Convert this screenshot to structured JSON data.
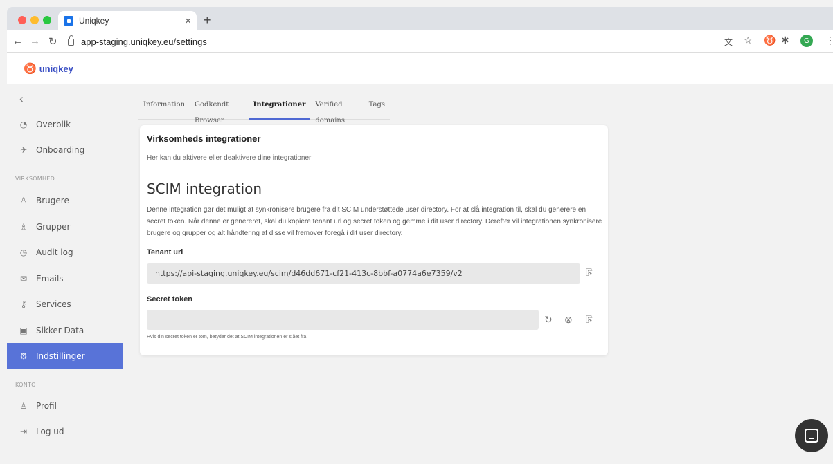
{
  "browser": {
    "tab_title": "Uniqkey",
    "tab_close": "×",
    "new_tab": "+",
    "url": "app-staging.uniqkey.eu/settings",
    "avatar_letter": "G"
  },
  "app": {
    "logo_text": "uniqkey"
  },
  "sidebar": {
    "items_top": [
      {
        "label": "Overblik",
        "icon": "gauge-icon"
      },
      {
        "label": "Onboarding",
        "icon": "rocket-icon"
      }
    ],
    "section_company": "VIRKSOMHED",
    "items_company": [
      {
        "label": "Brugere",
        "icon": "users-icon"
      },
      {
        "label": "Grupper",
        "icon": "groups-icon"
      },
      {
        "label": "Audit log",
        "icon": "clock-icon"
      },
      {
        "label": "Emails",
        "icon": "mail-icon"
      },
      {
        "label": "Services",
        "icon": "key-icon"
      },
      {
        "label": "Sikker Data",
        "icon": "briefcase-icon"
      },
      {
        "label": "Indstillinger",
        "icon": "gear-icon",
        "active": true
      }
    ],
    "section_account": "KONTO",
    "items_account": [
      {
        "label": "Profil",
        "icon": "user-icon"
      },
      {
        "label": "Log ud",
        "icon": "logout-icon"
      }
    ]
  },
  "tabs": [
    {
      "label": "Information"
    },
    {
      "label": "Godkendt Browser"
    },
    {
      "label": "Integrationer",
      "active": true
    },
    {
      "label": "Verified domains"
    },
    {
      "label": "Tags"
    }
  ],
  "card": {
    "title": "Virksomheds integrationer",
    "subtitle": "Her kan du aktivere eller deaktivere dine integrationer",
    "scim_title": "SCIM integration",
    "scim_description": "Denne integration gør det muligt at synkronisere brugere fra dit SCIM understøttede user directory. For at slå integration til, skal du generere en secret token. Når denne er genereret, skal du kopiere tenant url og secret token og gemme i dit user directory. Derefter vil integrationen synkronisere brugere og grupper og alt håndtering af disse vil fremover foregå i dit user directory.",
    "tenant_label": "Tenant url",
    "tenant_value": "https://api-staging.uniqkey.eu/scim/d46dd671-cf21-413c-8bbf-a0774a6e7359/v2",
    "secret_label": "Secret token",
    "secret_value": "",
    "hint": "Hvis din secret token er tom, betyder det at SCIM integrationen er slået fra."
  }
}
